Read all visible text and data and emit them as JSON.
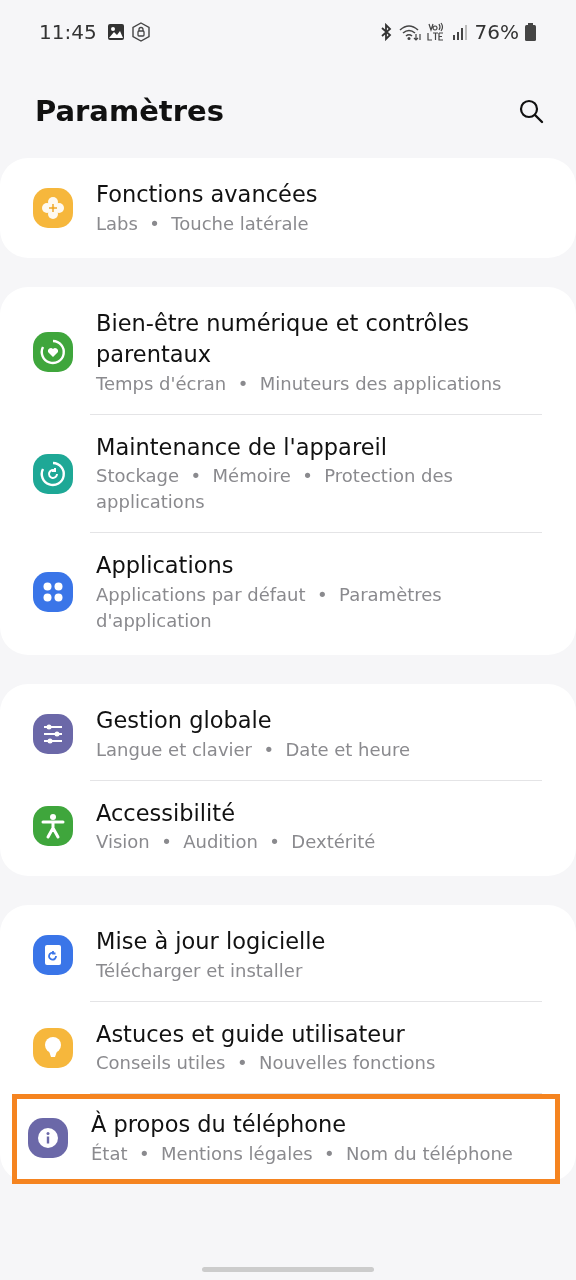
{
  "status_bar": {
    "time": "11:45",
    "battery": "76%"
  },
  "header": {
    "title": "Paramètres"
  },
  "groups": [
    {
      "items": [
        {
          "title": "Fonctions avancées",
          "details": "Labs  •  Touche latérale",
          "kind": "flower",
          "color": "#f6b73c",
          "highlighted": false
        }
      ]
    },
    {
      "items": [
        {
          "title": "Bien-être numérique et contrôles parentaux",
          "details": "Temps d'écran  •  Minuteurs des applications",
          "kind": "heart",
          "color": "#3fa63c",
          "highlighted": false
        },
        {
          "title": "Maintenance de l'appareil",
          "details": "Stockage  •  Mémoire  •  Protection des applications",
          "kind": "refresh",
          "color": "#1ea896",
          "highlighted": false
        },
        {
          "title": "Applications",
          "details": "Applications par défaut  •  Paramètres d'application",
          "kind": "dots",
          "color": "#3a75e8",
          "highlighted": false
        }
      ]
    },
    {
      "items": [
        {
          "title": "Gestion globale",
          "details": "Langue et clavier  •  Date et heure",
          "kind": "sliders",
          "color": "#6b68a8",
          "highlighted": false
        },
        {
          "title": "Accessibilité",
          "details": "Vision  •  Audition  •  Dextérité",
          "kind": "person",
          "color": "#3fa63c",
          "highlighted": false
        }
      ]
    },
    {
      "items": [
        {
          "title": "Mise à jour logicielle",
          "details": "Télécharger et installer",
          "kind": "update",
          "color": "#3a75e8",
          "highlighted": false
        },
        {
          "title": "Astuces et guide utilisateur",
          "details": "Conseils utiles  •  Nouvelles fonctions",
          "kind": "bulb",
          "color": "#f6b73c",
          "highlighted": false
        },
        {
          "title": "À propos du téléphone",
          "details": "État  •  Mentions légales  •  Nom du téléphone",
          "kind": "info",
          "color": "#6b68a8",
          "highlighted": true
        }
      ]
    }
  ]
}
